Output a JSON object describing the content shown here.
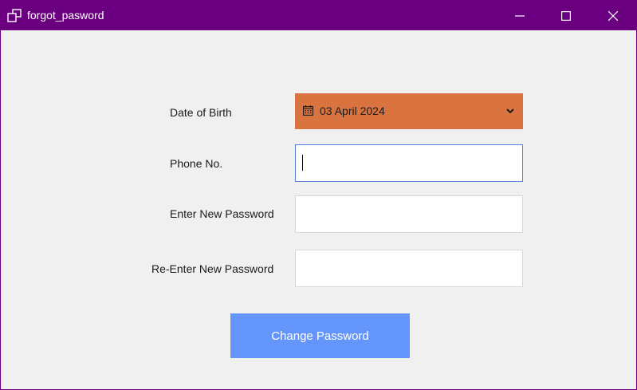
{
  "window": {
    "title": "forgot_pasword",
    "titlebar_color": "#6a0080",
    "icons": {
      "app": "app-window-icon",
      "minimize": "minimize-icon",
      "maximize": "maximize-icon",
      "close": "close-icon"
    }
  },
  "form": {
    "dob_label": "Date of Birth",
    "dob_value": "03 April 2024",
    "dob_bg_color": "#d97441",
    "phone_label": "Phone No.",
    "phone_value": "",
    "new_password_label": "Enter New Password",
    "new_password_value": "",
    "reenter_password_label": "Re-Enter New Password",
    "reenter_password_value": "",
    "submit_label": "Change Password",
    "submit_color": "#6495fb"
  }
}
